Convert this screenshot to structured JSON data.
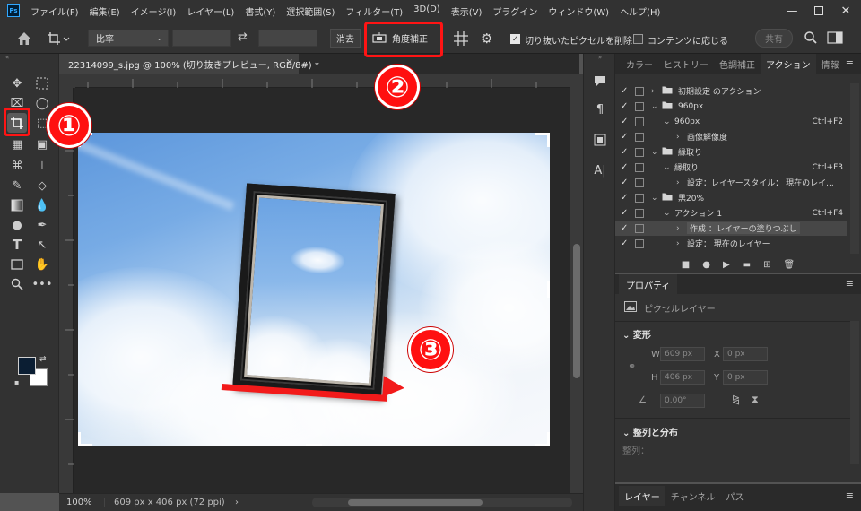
{
  "app": {
    "logo": "Ps",
    "menu": [
      "ファイル(F)",
      "編集(E)",
      "イメージ(I)",
      "レイヤー(L)",
      "書式(Y)",
      "選択範囲(S)",
      "フィルター(T)",
      "3D(D)",
      "表示(V)",
      "プラグイン",
      "ウィンドウ(W)",
      "ヘルプ(H)"
    ],
    "window_controls": [
      "minimize-icon",
      "maximize-icon",
      "close-icon"
    ]
  },
  "options": {
    "ratio_select": "比率",
    "clear_label": "消去",
    "straighten_label": "角度補正",
    "delete_cropped_label": "切り抜いたピクセルを削除",
    "delete_cropped_checked": true,
    "content_aware_label": "コンテンツに応じる",
    "content_aware_checked": false,
    "share_label": "共有"
  },
  "document": {
    "tab_title": "22314099_s.jpg @ 100% (切り抜きプレビュー, RGB/8#) *",
    "zoom": "100%",
    "size_info": "609 px x 406 px (72 ppi)"
  },
  "colors": {
    "foreground": "#0b1e33",
    "background": "#ffffff",
    "annotation_red": "#ff1414"
  },
  "annotations": [
    "①",
    "②",
    "③"
  ],
  "actions_panel": {
    "tabs": [
      "カラー",
      "ヒストリー",
      "色調補正",
      "アクション",
      "情報"
    ],
    "active_tab": "アクション",
    "rows": [
      {
        "check": "✓",
        "type": "set",
        "label": "初期設定 のアクション",
        "shortcut": "",
        "indent": 1
      },
      {
        "check": "✓",
        "type": "set",
        "label": "960px",
        "shortcut": "",
        "indent": 1
      },
      {
        "check": "✓",
        "type": "action",
        "label": "960px",
        "shortcut": "Ctrl+F2",
        "indent": 2
      },
      {
        "check": "✓",
        "type": "step",
        "label": "画像解像度",
        "shortcut": "",
        "indent": 3
      },
      {
        "check": "✓",
        "type": "set",
        "label": "縁取り",
        "shortcut": "",
        "indent": 1
      },
      {
        "check": "✓",
        "type": "action",
        "label": "縁取り",
        "shortcut": "Ctrl+F3",
        "indent": 2
      },
      {
        "check": "✓",
        "type": "step",
        "label": "設定：レイヤースタイル： 現在のレイ...",
        "shortcut": "",
        "indent": 3
      },
      {
        "check": "✓",
        "type": "set",
        "label": "黒20%",
        "shortcut": "",
        "indent": 1
      },
      {
        "check": "✓",
        "type": "action",
        "label": "アクション 1",
        "shortcut": "Ctrl+F4",
        "indent": 2
      },
      {
        "check": "✓",
        "type": "step",
        "label": "作成 ：レイヤーの塗りつぶし",
        "shortcut": "",
        "indent": 3,
        "selected": true
      },
      {
        "check": "✓",
        "type": "step",
        "label": "設定：  現在のレイヤー",
        "shortcut": "",
        "indent": 3
      }
    ]
  },
  "properties_panel": {
    "tab": "プロパティ",
    "layer_type": "ピクセルレイヤー",
    "transform_title": "変形",
    "w_label": "W",
    "w_value": "609 px",
    "x_label": "X",
    "x_value": "0 px",
    "h_label": "H",
    "h_value": "406 px",
    "y_label": "Y",
    "y_value": "0 px",
    "angle_value": "0.00°",
    "align_title": "整列と分布",
    "align_sub": "整列："
  },
  "layers_panel": {
    "tabs": [
      "レイヤー",
      "チャンネル",
      "パス"
    ],
    "active_tab": "レイヤー"
  }
}
